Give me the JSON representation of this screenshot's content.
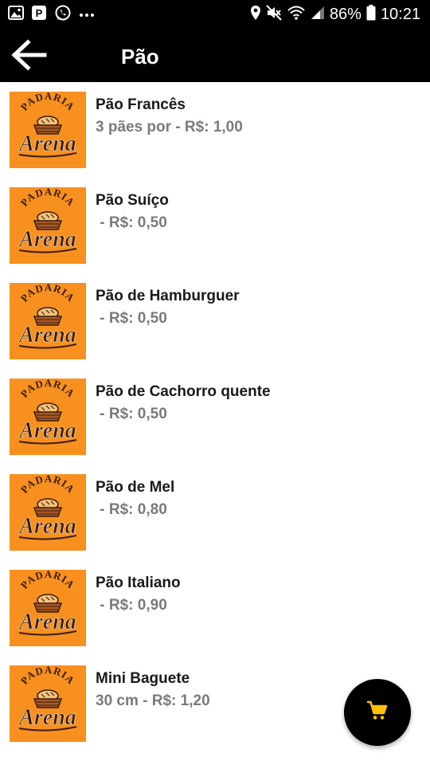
{
  "status_bar": {
    "battery": "86%",
    "time": "10:21",
    "icons": [
      "gallery-icon",
      "parking-icon",
      "whatsapp-icon",
      "more-dots-icon",
      "location-icon",
      "mute-icon",
      "wifi-icon",
      "signal-icon",
      "battery-icon"
    ]
  },
  "app_bar": {
    "title": "Pão",
    "back_icon": "arrow-back-icon"
  },
  "logo": {
    "brand_top": "PADARIA",
    "brand_main": "Arena",
    "background": "#f7901e"
  },
  "products": [
    {
      "name": "Pão Francês",
      "price": "3 pães por - R$: 1,00"
    },
    {
      "name": "Pão Suíço",
      "price": " - R$: 0,50"
    },
    {
      "name": "Pão de Hamburguer",
      "price": " - R$: 0,50"
    },
    {
      "name": "Pão de Cachorro quente",
      "price": " - R$: 0,50"
    },
    {
      "name": "Pão de Mel",
      "price": " - R$: 0,80"
    },
    {
      "name": "Pão Italiano",
      "price": " - R$: 0,90"
    },
    {
      "name": "Mini Baguete",
      "price": "30 cm - R$: 1,20"
    }
  ],
  "cart_fab": {
    "icon": "cart-icon",
    "icon_color": "#ffc107"
  }
}
